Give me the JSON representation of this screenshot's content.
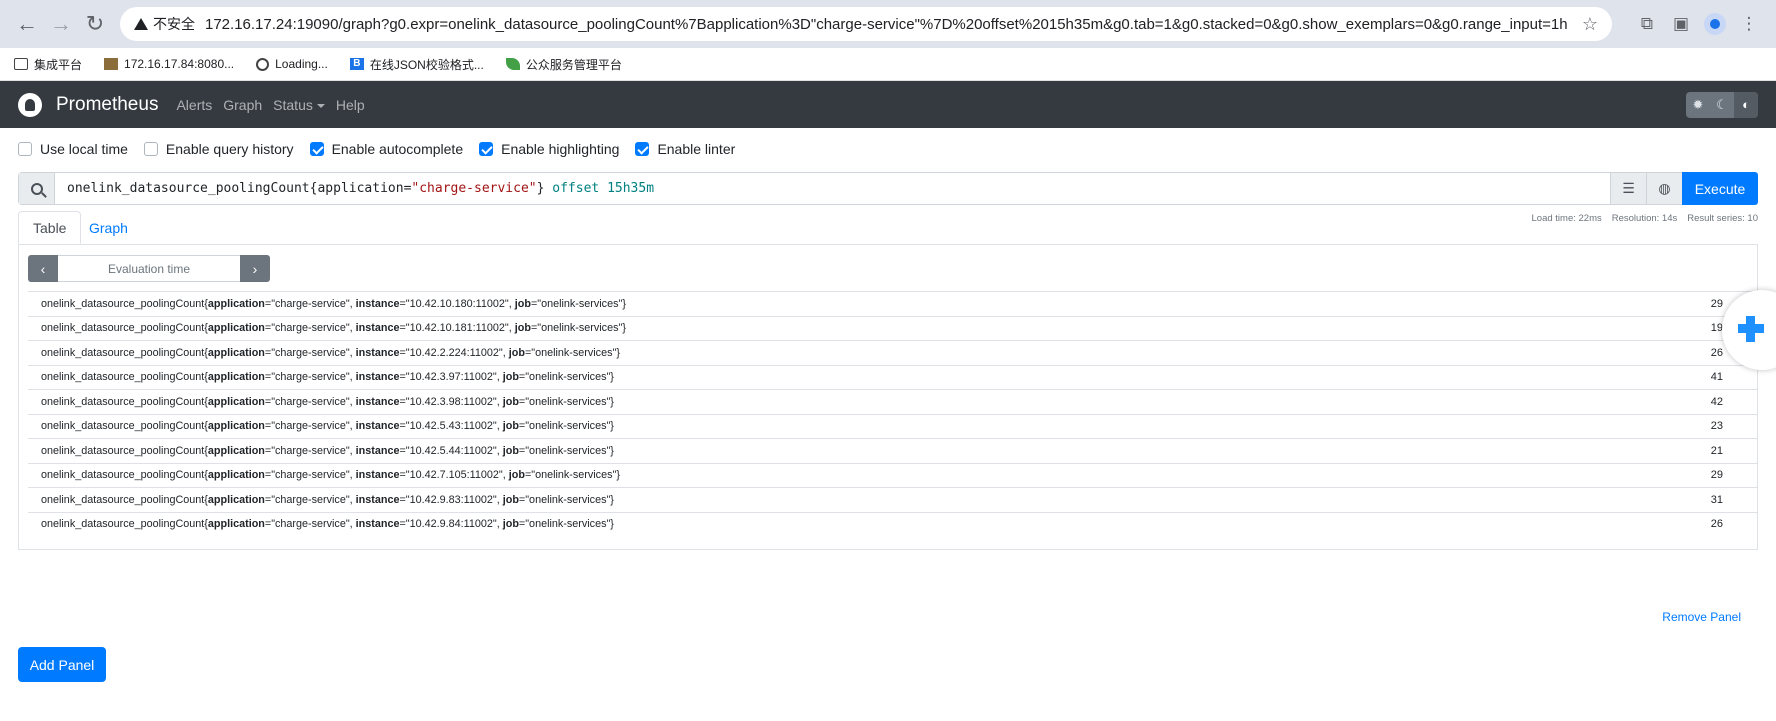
{
  "browser": {
    "insecure_label": "不安全",
    "url": "172.16.17.24:19090/graph?g0.expr=onelink_datasource_poolingCount%7Bapplication%3D\"charge-service\"%7D%20offset%2015h35m&g0.tab=1&g0.stacked=0&g0.show_exemplars=0&g0.range_input=1h",
    "bookmarks": [
      {
        "icon": "folder-icon",
        "label": "集成平台"
      },
      {
        "icon": "image-icon",
        "label": "172.16.17.84:8080..."
      },
      {
        "icon": "globe-icon",
        "label": "Loading..."
      },
      {
        "icon": "b-icon",
        "label": "在线JSON校验格式..."
      },
      {
        "icon": "leaf-icon",
        "label": "公众服务管理平台"
      }
    ]
  },
  "nav": {
    "brand": "Prometheus",
    "links": [
      "Alerts",
      "Graph",
      "Status",
      "Help"
    ]
  },
  "options": [
    {
      "label": "Use local time",
      "checked": false
    },
    {
      "label": "Enable query history",
      "checked": false
    },
    {
      "label": "Enable autocomplete",
      "checked": true
    },
    {
      "label": "Enable highlighting",
      "checked": true
    },
    {
      "label": "Enable linter",
      "checked": true
    }
  ],
  "expression": {
    "metric": "onelink_datasource_poolingCount",
    "label_key": "application",
    "label_value": "\"charge-service\"",
    "offset_kw": "offset",
    "offset_val": "15h35m"
  },
  "execute_label": "Execute",
  "tabs": [
    "Table",
    "Graph"
  ],
  "stats": {
    "load_time": "Load time: 22ms",
    "resolution": "Resolution: 14s",
    "result_series": "Result series: 10"
  },
  "eval_placeholder": "Evaluation time",
  "results": [
    {
      "instance": "\"10.42.10.180:11002\"",
      "value": "29"
    },
    {
      "instance": "\"10.42.10.181:11002\"",
      "value": "19"
    },
    {
      "instance": "\"10.42.2.224:11002\"",
      "value": "26"
    },
    {
      "instance": "\"10.42.3.97:11002\"",
      "value": "41"
    },
    {
      "instance": "\"10.42.3.98:11002\"",
      "value": "42"
    },
    {
      "instance": "\"10.42.5.43:11002\"",
      "value": "23"
    },
    {
      "instance": "\"10.42.5.44:11002\"",
      "value": "21"
    },
    {
      "instance": "\"10.42.7.105:11002\"",
      "value": "29"
    },
    {
      "instance": "\"10.42.9.83:11002\"",
      "value": "31"
    },
    {
      "instance": "\"10.42.9.84:11002\"",
      "value": "26"
    }
  ],
  "series_parts": {
    "metric": "onelink_datasource_poolingCount{",
    "app_key": "application",
    "app_val": "=\"charge-service\", ",
    "inst_key": "instance",
    "eq": "=",
    "sep": ", ",
    "job_key": "job",
    "job_val": "=\"onelink-services\"}"
  },
  "remove_panel": "Remove Panel",
  "add_panel": "Add Panel"
}
